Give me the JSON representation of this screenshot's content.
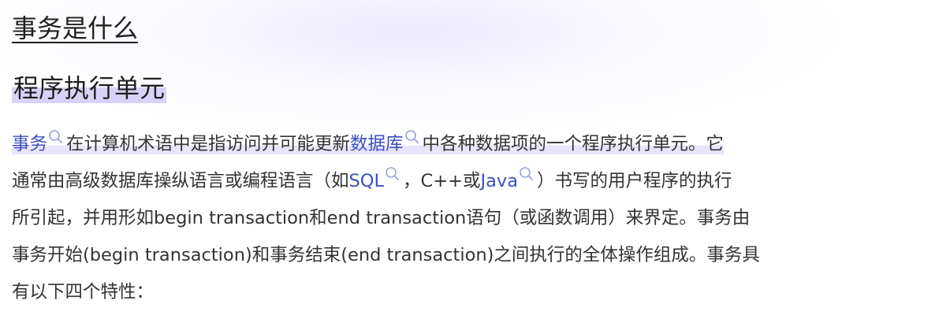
{
  "title": "事务是什么",
  "subtitle": "程序执行单元",
  "paragraph": {
    "line1": {
      "link_transaction": "事务",
      "text_a": "在计算机术语中是指访问并可能更新",
      "link_database": "数据库",
      "text_b": "中各种数据项的一个程序执行单元。它"
    },
    "line2": {
      "text_a": "通常由高级数据库操纵语言或编程语言（如",
      "link_sql": "SQL",
      "text_b": "，C++或",
      "link_java": "Java",
      "text_c": "）书写的用户程序的执行"
    },
    "line3": "所引起，并用形如begin transaction和end transaction语句（或函数调用）来界定。事务由",
    "line4": "事务开始(begin transaction)和事务结束(end transaction)之间执行的全体操作组成。事务具",
    "line5": "有以下四个特性："
  },
  "colors": {
    "link": "#3a50c2",
    "text": "#333333",
    "highlight": "#e0dbfa"
  },
  "icons": [
    "search-icon"
  ]
}
